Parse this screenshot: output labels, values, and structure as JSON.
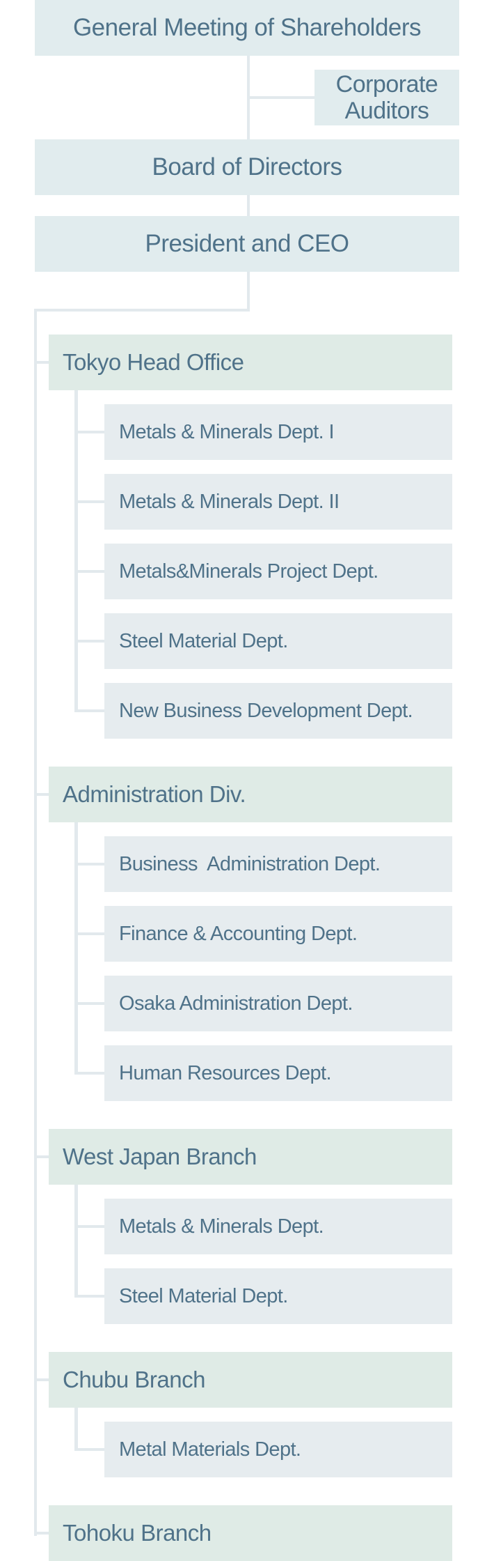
{
  "chart": {
    "top": {
      "shareholders": "General Meeting of Shareholders",
      "auditors_line1": "Corporate",
      "auditors_line2": "Auditors",
      "board": "Board of Directors",
      "president": "President and CEO"
    },
    "divisions": [
      {
        "name": "Tokyo Head Office",
        "departments": [
          "Metals & Minerals Dept. I",
          "Metals & Minerals Dept. II",
          "Metals&Minerals Project Dept.",
          "Steel Material Dept.",
          "New Business Development Dept."
        ]
      },
      {
        "name": "Administration Div.",
        "departments": [
          "Business  Administration Dept.",
          "Finance & Accounting Dept.",
          "Osaka Administration Dept.",
          "Human Resources Dept."
        ]
      },
      {
        "name": "West Japan Branch",
        "departments": [
          "Metals & Minerals Dept.",
          "Steel Material Dept."
        ]
      },
      {
        "name": "Chubu Branch",
        "departments": [
          "Metal Materials Dept."
        ]
      },
      {
        "name": "Tohoku Branch",
        "departments": []
      }
    ]
  },
  "colors": {
    "top_box": "#e1ecee",
    "division_box": "#dfebe6",
    "department_box": "#e6ecef",
    "connector": "#e2e9ed",
    "text": "#4f7289"
  }
}
